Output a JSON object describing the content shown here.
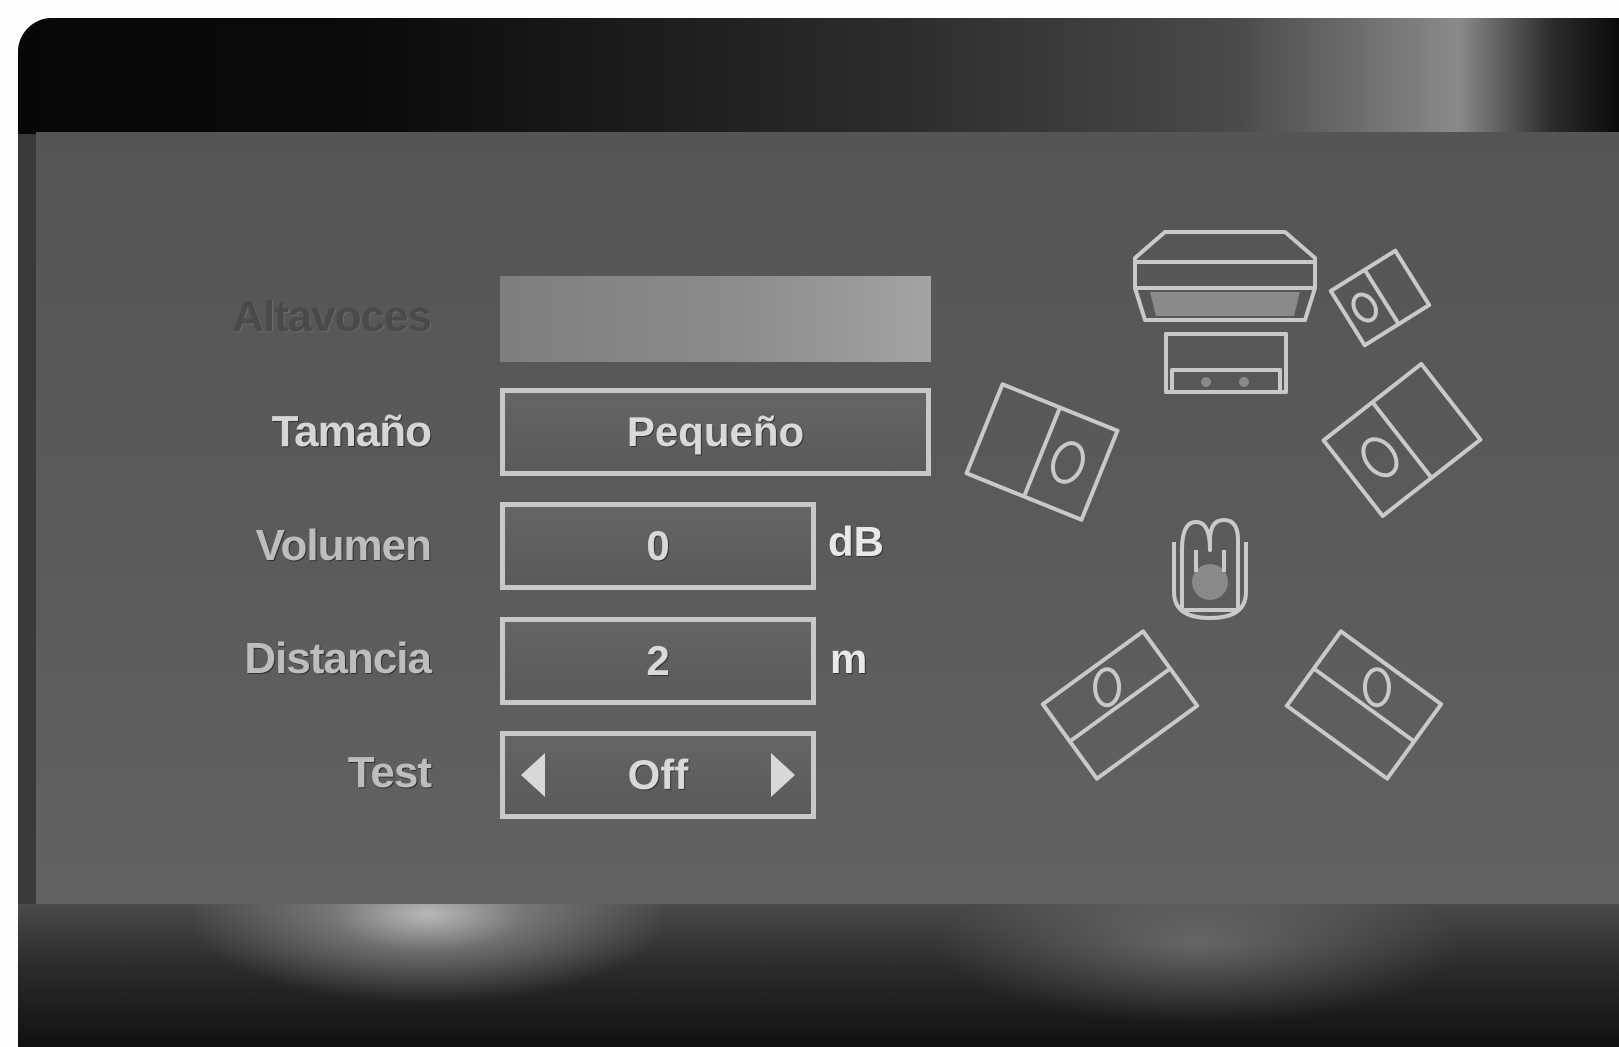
{
  "settings": {
    "rows": [
      {
        "label": "Altavoces",
        "value": ""
      },
      {
        "label": "Tamaño",
        "value": "Pequeño"
      },
      {
        "label": "Volumen",
        "value": "0",
        "unit": "dB"
      },
      {
        "label": "Distancia",
        "value": "2",
        "unit": "m"
      },
      {
        "label": "Test",
        "value": "Off"
      }
    ]
  },
  "diagram": {
    "icons": [
      "tv-icon",
      "center-speaker-icon",
      "front-left-speaker-icon",
      "front-right-speaker-icon",
      "front-right-tweeter-icon",
      "listener-icon",
      "surround-left-speaker-icon",
      "surround-right-speaker-icon"
    ]
  },
  "colors": {
    "panel": "#5a5a5a",
    "border": "#c8c8c8",
    "text": "#bdbdbd"
  }
}
